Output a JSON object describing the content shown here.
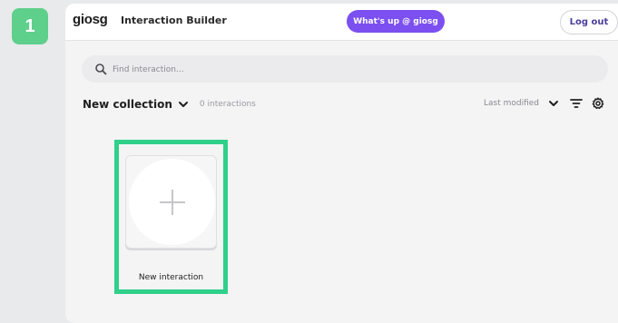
{
  "step": {
    "number": "1"
  },
  "header": {
    "logo": "giosg",
    "app_title": "Interaction Builder",
    "whats_up_label": "What's up @ giosg",
    "logout_label": "Log out"
  },
  "search": {
    "placeholder": "Find interaction...",
    "value": ""
  },
  "collection": {
    "name": "New collection",
    "count_label": "0 interactions"
  },
  "sort": {
    "label": "Last modified"
  },
  "interactions": [
    {
      "label": "New interaction",
      "icon": "plus-icon"
    }
  ],
  "colors": {
    "brand_purple": "#7b4ff0",
    "highlight_green": "#2fd08a",
    "step_badge": "#5fcf8c"
  }
}
